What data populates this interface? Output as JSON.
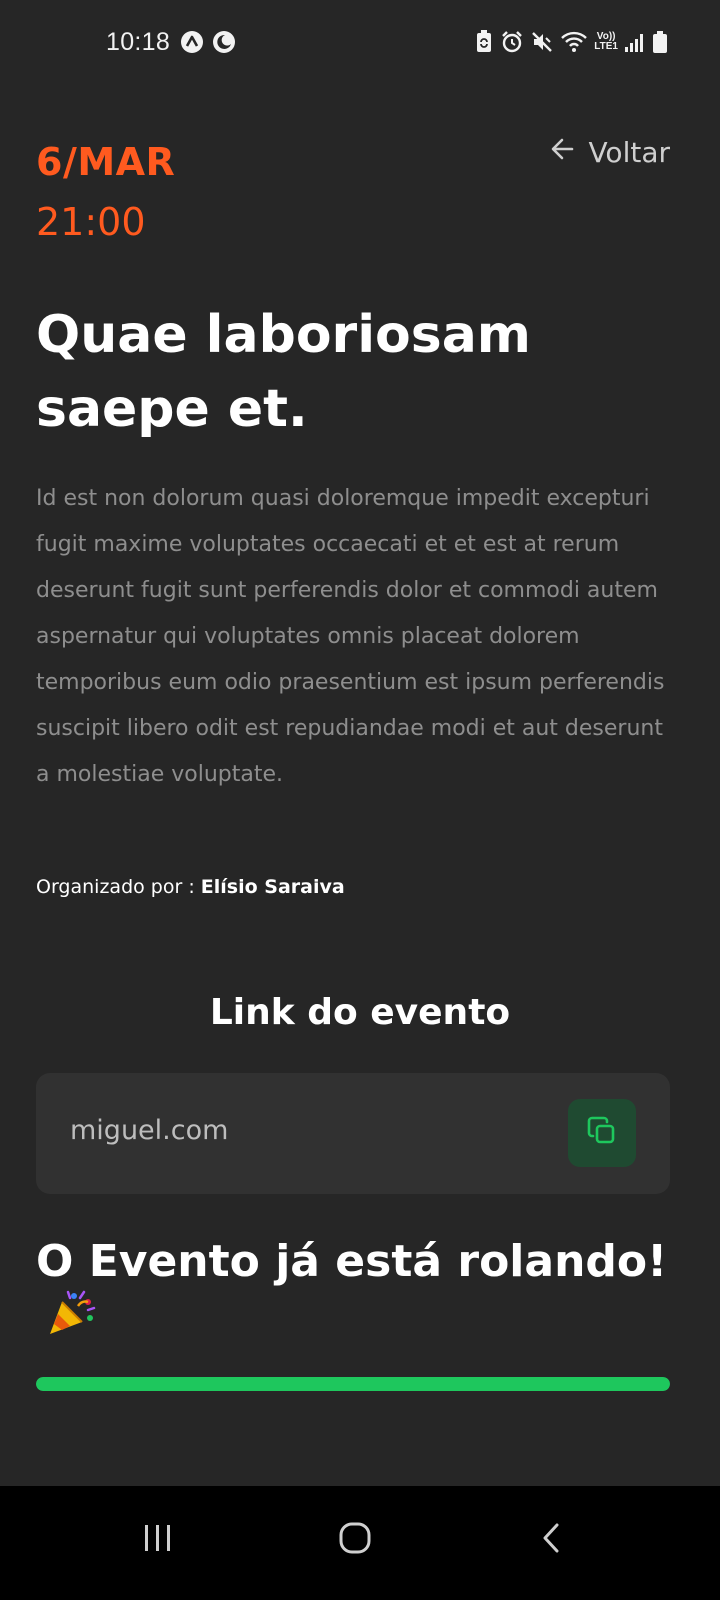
{
  "status_bar": {
    "time": "10:18",
    "lte_top": "Vo))",
    "lte_bottom": "LTE1"
  },
  "event": {
    "date": "6/MAR",
    "time": "21:00",
    "title": "Quae laboriosam saepe et.",
    "description": "Id est non dolorum quasi doloremque impedit excepturi fugit maxime voluptates occaecati et et est at rerum deserunt fugit sunt perferendis dolor et commodi autem aspernatur qui voluptates omnis placeat dolorem temporibus eum odio praesentium est ipsum perferendis suscipit libero odit est repudiandae modi et aut deserunt a molestiae voluptate.",
    "organizer_label": "Organizado por : ",
    "organizer_name": "Elísio Saraiva"
  },
  "nav": {
    "back_label": "Voltar"
  },
  "link_section": {
    "heading": "Link do evento",
    "url": "miguel.com"
  },
  "live": {
    "heading": "O Evento já está rolando!",
    "emoji": "🎉",
    "progress_percent": 100
  },
  "colors": {
    "accent_orange": "#ff5a1f",
    "accent_green": "#1ec75d",
    "background": "#262626"
  },
  "icons": {
    "back": "arrow-left-icon",
    "copy": "copy-icon",
    "party": "party-popper-icon"
  }
}
